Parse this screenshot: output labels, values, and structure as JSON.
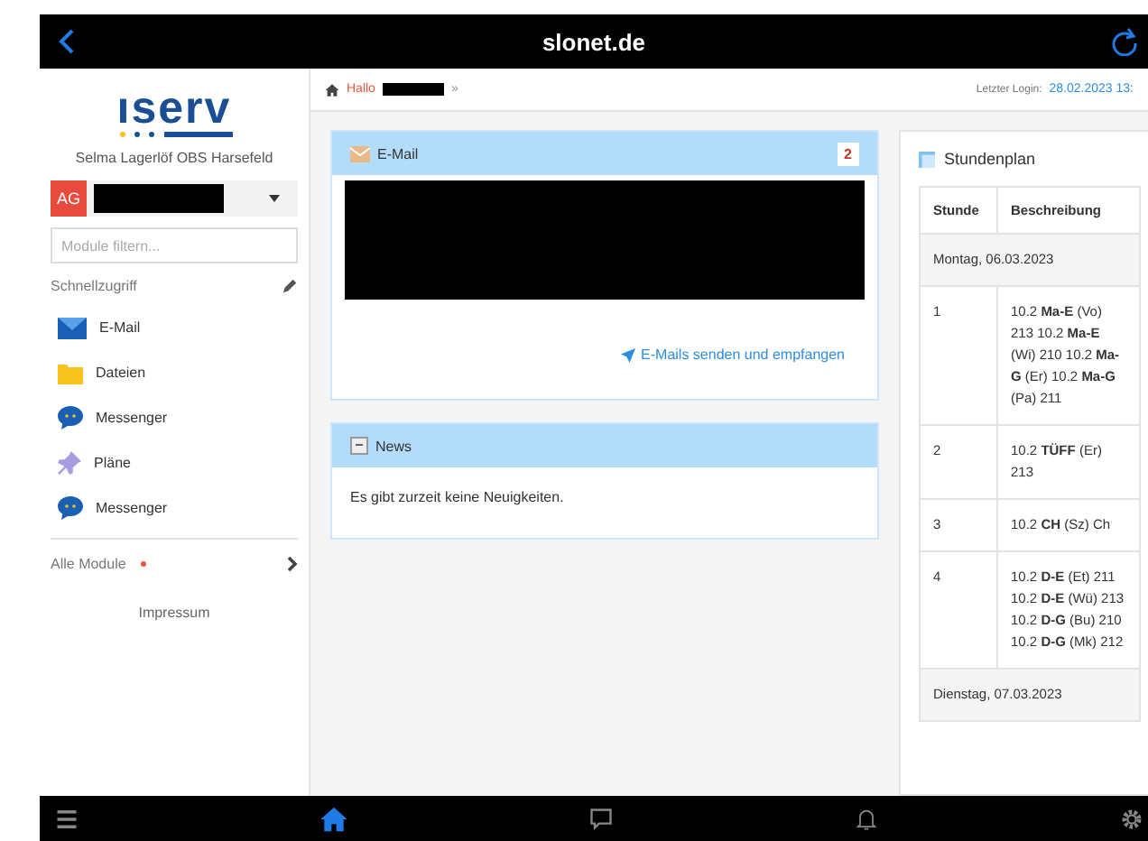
{
  "top_bar": {
    "title": "slonet.de"
  },
  "sidebar": {
    "logo": "ıserv",
    "school": "Selma Lagerlöf OBS Harsefeld",
    "user_initials": "AG",
    "filter_placeholder": "Module filtern...",
    "quick_access_label": "Schnellzugriff",
    "items": [
      {
        "label": "E-Mail",
        "kind": "mail"
      },
      {
        "label": "Dateien",
        "kind": "folder"
      },
      {
        "label": "Messenger",
        "kind": "chat"
      },
      {
        "label": "Pläne",
        "kind": "pin"
      },
      {
        "label": "Messenger",
        "kind": "chat"
      }
    ],
    "all_modules": {
      "label": "Alle Module",
      "color": "#e8563f"
    },
    "imprint": "Impressum"
  },
  "breadcrumb": {
    "greeting": "Hallo",
    "separator": "»",
    "last_login_label": "Letzter Login:",
    "last_login_value": "28.02.2023 13:"
  },
  "email_panel": {
    "title": "E-Mail",
    "count": "2",
    "link": "E-Mails senden und empfangen"
  },
  "news_panel": {
    "title": "News",
    "text": "Es gibt zurzeit keine Neuigkeiten."
  },
  "timetable": {
    "title": "Stundenplan",
    "columns": [
      "Stunde",
      "Beschreibung"
    ],
    "rows": [
      {
        "kind": "day",
        "text": "Montag, 06.03.2023"
      },
      {
        "kind": "lesson",
        "period": "1",
        "description": "10.2 **Ma-E** (Vo) 213 10.2 **Ma-E** (Wi) 210 10.2 **Ma-G** (Er) 10.2 **Ma-G** (Pa) 211"
      },
      {
        "kind": "lesson",
        "period": "2",
        "description": "10.2 **TÜFF** (Er) 213"
      },
      {
        "kind": "lesson",
        "period": "3",
        "description": "10.2 **CH** (Sz) Ch"
      },
      {
        "kind": "lesson",
        "period": "4",
        "description": "10.2 **D-E** (Et) 211 10.2 **D-E** (Wü) 213 10.2 **D-G** (Bu) 210 10.2 **D-G** (Mk) 212"
      },
      {
        "kind": "day",
        "text": "Dienstag, 07.03.2023"
      }
    ]
  },
  "bottom_bar": {
    "tabs": [
      {
        "kind": "menu",
        "selected": false
      },
      {
        "kind": "home",
        "selected": true
      },
      {
        "kind": "chat",
        "selected": false
      },
      {
        "kind": "bell",
        "selected": false
      },
      {
        "kind": "gear",
        "selected": false
      }
    ]
  }
}
